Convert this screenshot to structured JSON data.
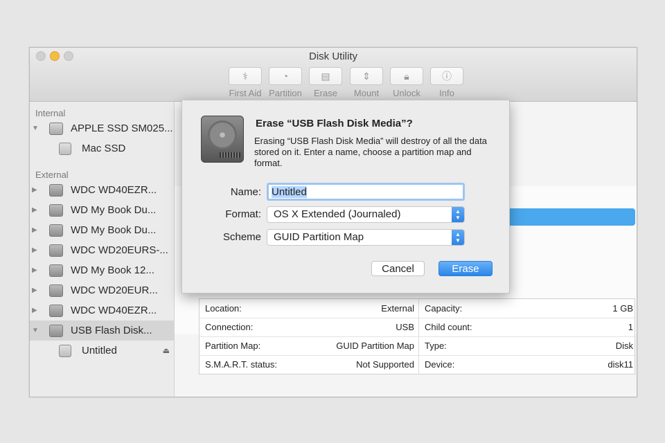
{
  "window": {
    "title": "Disk Utility"
  },
  "toolbar": [
    {
      "label": "First Aid",
      "icon": "stethoscope-icon"
    },
    {
      "label": "Partition",
      "icon": "pie-icon"
    },
    {
      "label": "Erase",
      "icon": "erase-icon"
    },
    {
      "label": "Mount",
      "icon": "mount-icon"
    },
    {
      "label": "Unlock",
      "icon": "lock-icon"
    },
    {
      "label": "Info",
      "icon": "info-icon"
    }
  ],
  "sidebar": {
    "internal_heading": "Internal",
    "external_heading": "External",
    "internal": [
      {
        "label": "APPLE SSD SM025...",
        "kind": "disk"
      },
      {
        "label": "Mac SSD",
        "kind": "volume"
      }
    ],
    "external": [
      {
        "label": "WDC WD40EZR..."
      },
      {
        "label": "WD My Book Du..."
      },
      {
        "label": "WD My Book Du..."
      },
      {
        "label": "WDC WD20EURS-..."
      },
      {
        "label": "WD My Book 12..."
      },
      {
        "label": "WDC WD20EUR..."
      },
      {
        "label": "WDC WD40EZR..."
      },
      {
        "label": "USB Flash Disk...",
        "selected": true
      },
      {
        "label": "Untitled",
        "kind": "volume"
      }
    ]
  },
  "info": {
    "rows": [
      {
        "k1": "Location:",
        "v1": "External",
        "k2": "Capacity:",
        "v2": "1 GB"
      },
      {
        "k1": "Connection:",
        "v1": "USB",
        "k2": "Child count:",
        "v2": "1"
      },
      {
        "k1": "Partition Map:",
        "v1": "GUID Partition Map",
        "k2": "Type:",
        "v2": "Disk"
      },
      {
        "k1": "S.M.A.R.T. status:",
        "v1": "Not Supported",
        "k2": "Device:",
        "v2": "disk11"
      }
    ]
  },
  "dialog": {
    "title": "Erase “USB Flash Disk Media”?",
    "message": "Erasing “USB Flash Disk Media” will destroy of all the data stored on it. Enter a name, choose a partition map and format.",
    "name_label": "Name:",
    "name_value": "Untitled",
    "format_label": "Format:",
    "format_value": "OS X Extended (Journaled)",
    "scheme_label": "Scheme",
    "scheme_value": "GUID Partition Map",
    "cancel_label": "Cancel",
    "erase_label": "Erase"
  },
  "colors": {
    "accent": "#2a86e8",
    "selection_bar": "#4aa8ee",
    "minimize": "#f5be41"
  }
}
